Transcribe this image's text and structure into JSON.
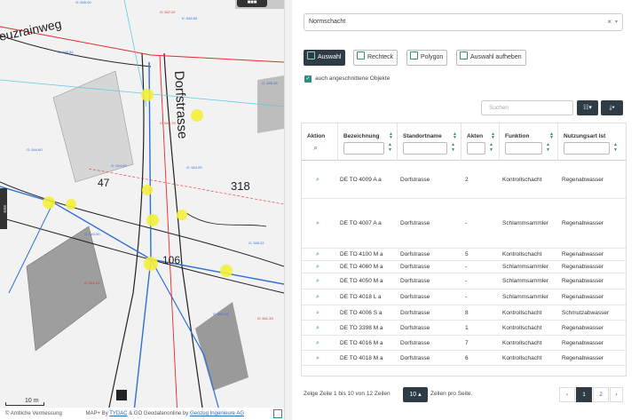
{
  "map": {
    "street_1": "Dorfstrasse",
    "street_2": "euzrainweg",
    "parcel_47": "47",
    "parcel_318": "318",
    "parcel_106": "106",
    "scale": "10 m",
    "attribution_prefix": "© Amtliche Vermessung",
    "attribution_mid": "MAP+ By",
    "attribution_link1": "TYDAC",
    "attribution_mid2": "& GO Geodatenonline by",
    "attribution_link2": "Geozug Ingenieure AG",
    "colors": {
      "sewer_blue": "#2f6fd6",
      "red": "#e02b2b",
      "cyan": "#5ec9e8",
      "marker": "#f5ef3a"
    }
  },
  "panel": {
    "dropdown_value": "Normschacht",
    "buttons": {
      "select": "Auswahl",
      "rectangle": "Rechteck",
      "polygon": "Polygon",
      "clear": "Auswahl aufheben"
    },
    "checkbox_label": "auch angeschnittene Objekte",
    "search_placeholder": "Suchen",
    "columns": {
      "action": "Aktion",
      "name": "Bezeichnung",
      "location": "Standortname",
      "files": "Akten",
      "function": "Funktion",
      "usage": "Nutzungsart Ist"
    },
    "rows": [
      {
        "name": "DE TO 4009 A a",
        "location": "Dorfstrasse",
        "files": "2",
        "function": "Kontrollschacht",
        "usage": "Regenabwasser"
      },
      {
        "name": "DE TO 4007 A a",
        "location": "Dorfstrasse",
        "files": "-",
        "function": "Schlammsammler",
        "usage": "Regenabwasser"
      },
      {
        "name": "DE TO 4100 M a",
        "location": "Dorfstrasse",
        "files": "5",
        "function": "Kontrollschacht",
        "usage": "Regenabwasser"
      },
      {
        "name": "DE TO 4060 M a",
        "location": "Dorfstrasse",
        "files": "-",
        "function": "Schlammsammler",
        "usage": "Regenabwasser"
      },
      {
        "name": "DE TO 4050 M a",
        "location": "Dorfstrasse",
        "files": "-",
        "function": "Schlammsammler",
        "usage": "Regenabwasser"
      },
      {
        "name": "DE TO 4018 L a",
        "location": "Dorfstrasse",
        "files": "-",
        "function": "Schlammsammler",
        "usage": "Regenabwasser"
      },
      {
        "name": "DE TO 4006 S a",
        "location": "Dorfstrasse",
        "files": "8",
        "function": "Kontrollschacht",
        "usage": "Schmutzabwasser"
      },
      {
        "name": "DE TO 3398 M a",
        "location": "Dorfstrasse",
        "files": "1",
        "function": "Kontrollschacht",
        "usage": "Regenabwasser"
      },
      {
        "name": "DE TO 4016 M a",
        "location": "Dorfstrasse",
        "files": "7",
        "function": "Kontrollschacht",
        "usage": "Regenabwasser"
      },
      {
        "name": "DE TO 4018 M a",
        "location": "Dorfstrasse",
        "files": "6",
        "function": "Kontrollschacht",
        "usage": "Regenabwasser"
      }
    ],
    "footer_left": "Zeige Zeile 1 bis 10 von 12 Zeilen",
    "page_size": "10 ▴",
    "footer_right": "Zeilen pro Seite.",
    "pagination": {
      "prev": "‹",
      "page1": "1",
      "page2": "2",
      "next": "›"
    },
    "colors": {
      "accent": "#2a8f7a",
      "dark": "#2f3b45"
    }
  }
}
